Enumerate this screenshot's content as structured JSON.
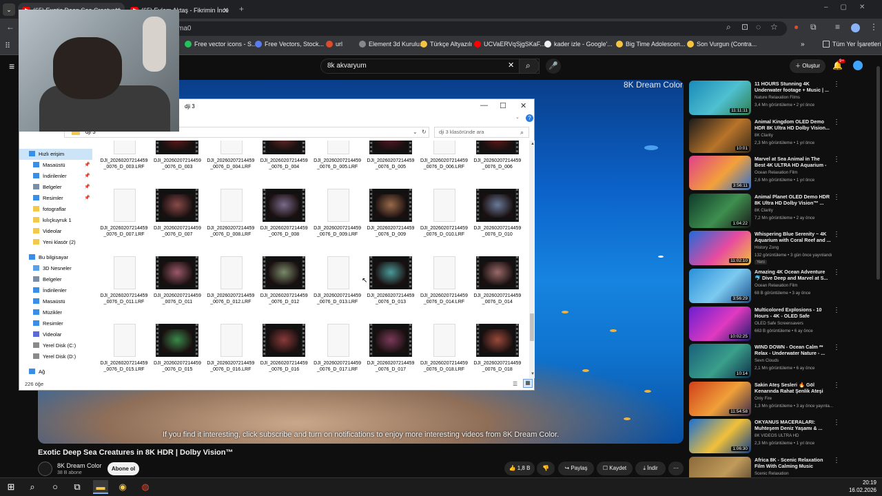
{
  "browser": {
    "tabs": [
      {
        "label": "(65) Exotic Deep Sea Creatures",
        "active": true
      },
      {
        "label": "(65) Eylem Aktaş - Fikrimin İnce",
        "active": false
      }
    ],
    "omnibox_text": "ma0",
    "bookmarks": [
      {
        "label": "Free vector icons - S...",
        "color": "#21c35a"
      },
      {
        "label": "Free Vectors, Stock...",
        "color": "#5b7cf0"
      },
      {
        "label": "url",
        "color": "#e04b2d"
      },
      {
        "label": "Element 3d Kurulu...",
        "color": "#888888"
      },
      {
        "label": "Türkçe Altyazılı",
        "color": "#f5c542"
      },
      {
        "label": "UCVaERVqSjgSKaF...",
        "color": "#ff0000"
      },
      {
        "label": "kader izle - Google'...",
        "color": "#f1f1f1"
      },
      {
        "label": "Big Time Adolescen...",
        "color": "#f5c542"
      },
      {
        "label": "Son Vurgun (Contra...",
        "color": "#f5c542"
      }
    ],
    "all_bookmarks_label": "Tüm Yer İşaretleri"
  },
  "youtube": {
    "search_value": "8k akvaryum",
    "create_label": "Oluştur",
    "notification_badge": "9+",
    "video": {
      "watermark": "8K Dream Color",
      "caption": "If you find it interesting, click subscribe and turn on notifications to enjoy more interesting videos from 8K Dream Color.",
      "title": "Exotic Deep Sea Creatures in 8K HDR | Dolby Vision™",
      "channel": "8K Dream Color",
      "subscribers": "38 B abone",
      "subscribe_label": "Abone ol",
      "likes": "1,8 B",
      "share_label": "Paylaş",
      "save_label": "Kaydet",
      "download_label": "İndir"
    },
    "recommendations": [
      {
        "title": "11 HOURS Stunning 4K Underwater footage + Music | ...",
        "channel": "Nature Relaxation Films",
        "meta": "3,4 Mn görüntüleme • 2 yıl önce",
        "duration": "11:11:11",
        "colors": [
          "#1a8ab8",
          "#4fc0d0",
          "#2e7d4f"
        ]
      },
      {
        "title": "Animal Kingdom OLED Demo HDR 8K Ultra HD Dolby Vision...",
        "channel": "8K Clarity",
        "meta": "2,3 Mn görüntüleme • 1 yıl önce",
        "duration": "10:01",
        "colors": [
          "#1b1b1b",
          "#b8742a",
          "#3a2a1a"
        ]
      },
      {
        "title": "Marvel at Sea Animal in The Best 4K ULTRA HD Aquarium - ...",
        "channel": "Ocean Relaxation Film",
        "meta": "2,6 Mn görüntüleme • 1 yıl önce",
        "duration": "3:56:11",
        "colors": [
          "#e0408a",
          "#f3a13a",
          "#2a6fd6"
        ]
      },
      {
        "title": "Animal Planet OLED Demo HDR 8K Ultra HD Dolby Vision™ ...",
        "channel": "8K Clarity",
        "meta": "7,2 Mn görüntüleme • 2 ay önce",
        "duration": "1:04:22",
        "colors": [
          "#0f3a2a",
          "#3f8f4f",
          "#1a1a1a"
        ]
      },
      {
        "title": "Whispering Blue Serenity ~ 4K Aquarium with Coral Reef and ...",
        "channel": "History Zong",
        "meta": "132 görüntüleme • 3 gün önce yayınlandı",
        "badge": "Yeni",
        "duration": "11:02:10",
        "colors": [
          "#1f6ad8",
          "#e84aa0",
          "#f2c23a"
        ]
      },
      {
        "title": "Amazing 4K Ocean Adventure 🐬 Dive Deep and Marvel at S...",
        "channel": "Ocean Relaxation Film",
        "meta": "68 B görüntüleme • 3 ay önce",
        "duration": "3:56:29",
        "colors": [
          "#2a8fd8",
          "#7ccaf0",
          "#1a4f8a"
        ]
      },
      {
        "title": "Multicolored Explosions - 10 Hours - 4K - OLED Safe",
        "channel": "OLED Safe Screensavers",
        "meta": "663 B görüntüleme • 6 ay önce",
        "duration": "10:02:25",
        "colors": [
          "#6a1fd0",
          "#e03ac0",
          "#1a1a6a"
        ]
      },
      {
        "title": "WIND DOWN - Ocean Calm ** Relax - Underwater Nature - ...",
        "channel": "Sevn Clouds",
        "meta": "2,1 Mn görüntüleme • 6 ay önce",
        "duration": "10:14",
        "colors": [
          "#1a5f7a",
          "#3a9f8a",
          "#0f2f4a"
        ]
      },
      {
        "title": "Sakin Ateş Sesleri 🔥 Göl Kenarında Rahat Şenlik Ateşi",
        "channel": "Only Fire",
        "meta": "1,3 Mn görüntüleme • 3 ay önce yayınla...",
        "duration": "11:54:58",
        "colors": [
          "#d0401a",
          "#f0a03a",
          "#3a2a4a"
        ]
      },
      {
        "title": "OKYANUS MACERALARI: Muhteşem Deniz Yaşamı & ...",
        "channel": "8K VIDEOS ULTRA HD",
        "meta": "2,3 Mn görüntüleme • 1 yıl önce",
        "duration": "1:06:30",
        "colors": [
          "#1a6fd0",
          "#f0c03a",
          "#0f3f8a"
        ]
      },
      {
        "title": "Africa 8K - Scenic Relaxation Film With Calming Music",
        "channel": "Scenic Relaxation",
        "meta": "",
        "duration": "",
        "colors": [
          "#8a6a3a",
          "#c09a5a",
          "#4a3a2a"
        ]
      }
    ]
  },
  "explorer": {
    "title": "dji 3",
    "breadcrumb": "dji 3",
    "search_placeholder": "dji 3 klasöründe ara",
    "status": "226 öğe",
    "nav": [
      {
        "label": "Hızlı erişim",
        "indent": 0,
        "color": "#3a8ee6",
        "selected": true
      },
      {
        "label": "Masaüstü",
        "indent": 1,
        "color": "#3a8ee6",
        "pinned": true
      },
      {
        "label": "İndirilenler",
        "indent": 1,
        "color": "#3a8ee6",
        "pinned": true
      },
      {
        "label": "Belgeler",
        "indent": 1,
        "color": "#7a8ea6",
        "pinned": true
      },
      {
        "label": "Resimler",
        "indent": 1,
        "color": "#3a8ee6",
        "pinned": true
      },
      {
        "label": "fotograflar",
        "indent": 1,
        "color": "#f2c94c"
      },
      {
        "label": "kılıçkuyruk 1",
        "indent": 1,
        "color": "#f2c94c"
      },
      {
        "label": "Videolar",
        "indent": 1,
        "color": "#f2c94c"
      },
      {
        "label": "Yeni klasör (2)",
        "indent": 1,
        "color": "#f2c94c"
      },
      {
        "label": "Bu bilgisayar",
        "indent": 0,
        "color": "#3a8ee6"
      },
      {
        "label": "3D Nesneler",
        "indent": 1,
        "color": "#5aa0e6"
      },
      {
        "label": "Belgeler",
        "indent": 1,
        "color": "#7a8ea6"
      },
      {
        "label": "İndirilenler",
        "indent": 1,
        "color": "#3a8ee6"
      },
      {
        "label": "Masaüstü",
        "indent": 1,
        "color": "#3a8ee6"
      },
      {
        "label": "Müzikler",
        "indent": 1,
        "color": "#3a8ee6"
      },
      {
        "label": "Resimler",
        "indent": 1,
        "color": "#3a8ee6"
      },
      {
        "label": "Videolar",
        "indent": 1,
        "color": "#5a6ad6"
      },
      {
        "label": "Yerel Disk (C:)",
        "indent": 1,
        "color": "#8a8a8a"
      },
      {
        "label": "Yerel Disk (D:)",
        "indent": 1,
        "color": "#8a8a8a"
      },
      {
        "label": "Ağ",
        "indent": 0,
        "color": "#3a8ee6"
      }
    ],
    "files": [
      {
        "name": "DJI_20260207214459_0076_D_003.LRF",
        "type": "doc"
      },
      {
        "name": "DJI_20260207214459_0076_D_003",
        "type": "vid",
        "tint": "#6a1a1a"
      },
      {
        "name": "DJI_20260207214459_0076_D_004.LRF",
        "type": "doc"
      },
      {
        "name": "DJI_20260207214459_0076_D_004",
        "type": "vid",
        "tint": "#6a2a2a"
      },
      {
        "name": "DJI_20260207214459_0076_D_005.LRF",
        "type": "doc"
      },
      {
        "name": "DJI_20260207214459_0076_D_005",
        "type": "vid",
        "tint": "#5a1a2a"
      },
      {
        "name": "DJI_20260207214459_0076_D_006.LRF",
        "type": "doc"
      },
      {
        "name": "DJI_20260207214459_0076_D_006",
        "type": "vid",
        "tint": "#6a1a1a"
      },
      {
        "name": "DJI_20260207214459_0076_D_007.LRF",
        "type": "doc"
      },
      {
        "name": "DJI_20260207214459_0076_D_007",
        "type": "vid",
        "tint": "#8a4a4a"
      },
      {
        "name": "DJI_20260207214459_0076_D_008.LRF",
        "type": "doc"
      },
      {
        "name": "DJI_20260207214459_0076_D_008",
        "type": "vid",
        "tint": "#7a6a8a"
      },
      {
        "name": "DJI_20260207214459_0076_D_009.LRF",
        "type": "doc"
      },
      {
        "name": "DJI_20260207214459_0076_D_009",
        "type": "vid",
        "tint": "#9a6a4a"
      },
      {
        "name": "DJI_20260207214459_0076_D_010.LRF",
        "type": "doc"
      },
      {
        "name": "DJI_20260207214459_0076_D_010",
        "type": "vid",
        "tint": "#6a7a9a"
      },
      {
        "name": "DJI_20260207214459_0076_D_011.LRF",
        "type": "doc"
      },
      {
        "name": "DJI_20260207214459_0076_D_011",
        "type": "vid",
        "tint": "#9a5a6a"
      },
      {
        "name": "DJI_20260207214459_0076_D_012.LRF",
        "type": "doc"
      },
      {
        "name": "DJI_20260207214459_0076_D_012",
        "type": "vid",
        "tint": "#7a8a6a"
      },
      {
        "name": "DJI_20260207214459_0076_D_013.LRF",
        "type": "doc"
      },
      {
        "name": "DJI_20260207214459_0076_D_013",
        "type": "vid",
        "tint": "#4a9a9a"
      },
      {
        "name": "DJI_20260207214459_0076_D_014.LRF",
        "type": "doc"
      },
      {
        "name": "DJI_20260207214459_0076_D_014",
        "type": "vid",
        "tint": "#9a6a6a"
      },
      {
        "name": "DJI_20260207214459_0076_D_015.LRF",
        "type": "doc"
      },
      {
        "name": "DJI_20260207214459_0076_D_015",
        "type": "vid",
        "tint": "#3a8a4a"
      },
      {
        "name": "DJI_20260207214459_0076_D_016.LRF",
        "type": "doc"
      },
      {
        "name": "DJI_20260207214459_0076_D_016",
        "type": "vid",
        "tint": "#8a3a3a"
      },
      {
        "name": "DJI_20260207214459_0076_D_017.LRF",
        "type": "doc"
      },
      {
        "name": "DJI_20260207214459_0076_D_017",
        "type": "vid",
        "tint": "#7a3a5a"
      },
      {
        "name": "DJI_20260207214459_0076_D_018.LRF",
        "type": "doc"
      },
      {
        "name": "DJI_20260207214459_0076_D_018",
        "type": "vid",
        "tint": "#9a4a3a"
      }
    ]
  },
  "taskbar": {
    "time": "20:19",
    "date": "16.02.2026"
  }
}
